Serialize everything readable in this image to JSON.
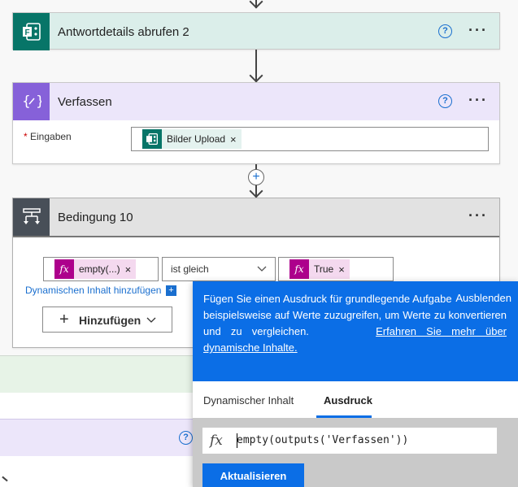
{
  "colors": {
    "forms_green": "#077568",
    "compose_purple": "#8661d9",
    "condition_gray": "#484f58",
    "fx_magenta": "#ad008c",
    "accent_blue": "#0b6ee6"
  },
  "step1": {
    "title": "Antwortdetails abrufen 2",
    "icon": "forms-icon",
    "help": "?",
    "more": "···"
  },
  "step2": {
    "title": "Verfassen",
    "icon": "compose-icon",
    "help": "?",
    "more": "···",
    "inputs_required": "*",
    "inputs_label": "Eingaben",
    "token_label": "Bilder Upload",
    "token_remove": "×"
  },
  "step3": {
    "title": "Bedingung 10",
    "icon": "condition-icon",
    "more": "···",
    "left_token_label": "empty(...)",
    "left_token_fx": "fx",
    "left_token_remove": "×",
    "operator": "ist gleich",
    "right_token_label": "True",
    "right_token_fx": "fx",
    "right_token_remove": "×",
    "dynamic_link": "Dynamischen Inhalt hinzufügen",
    "dynamic_plus": "+",
    "add_button": "Hinzufügen"
  },
  "background": {
    "help": "?"
  },
  "popup": {
    "hide": "Ausblenden",
    "description": "Fügen Sie einen Ausdruck für grundlegende Aufgaben hinzu, um beispielsweise auf Werte zuzugreifen, um Werte zu konvertieren und zu vergleichen.",
    "learn_more": "Erfahren Sie mehr über dynamische Inhalte.",
    "tabs": [
      "Dynamischer Inhalt",
      "Ausdruck"
    ],
    "active_tab": "Ausdruck",
    "fx": "fx",
    "expression": "empty(outputs('Verfassen'))",
    "update_button": "Aktualisieren"
  }
}
